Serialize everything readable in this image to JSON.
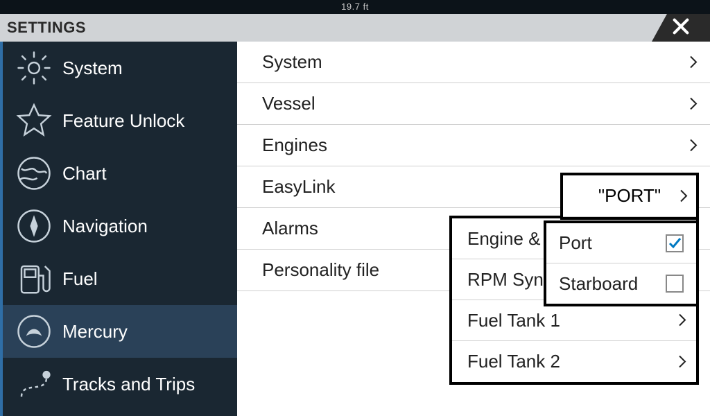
{
  "topbar": {
    "depth": "19.7 ft"
  },
  "header": {
    "title": "SETTINGS"
  },
  "sidebar": {
    "selected_index": 6,
    "items": [
      {
        "label": "System"
      },
      {
        "label": "Feature Unlock"
      },
      {
        "label": "Chart"
      },
      {
        "label": "Navigation"
      },
      {
        "label": "Fuel"
      },
      {
        "label": "Mercury"
      },
      {
        "label": "Tracks and Trips"
      }
    ]
  },
  "main": {
    "rows": [
      {
        "label": "System"
      },
      {
        "label": "Vessel"
      },
      {
        "label": "Engines"
      },
      {
        "label": "EasyLink"
      },
      {
        "label": "Alarms"
      },
      {
        "label": "Personality file"
      }
    ]
  },
  "popup_easylink": {
    "rows": [
      {
        "label": "Engine &"
      },
      {
        "label": "RPM Syn"
      },
      {
        "label": "Fuel Tank 1"
      },
      {
        "label": "Fuel Tank 2"
      }
    ]
  },
  "popup_port_header": {
    "label": "\"PORT\""
  },
  "popup_side_select": {
    "options": [
      {
        "label": "Port",
        "checked": true
      },
      {
        "label": "Starboard",
        "checked": false
      }
    ]
  }
}
